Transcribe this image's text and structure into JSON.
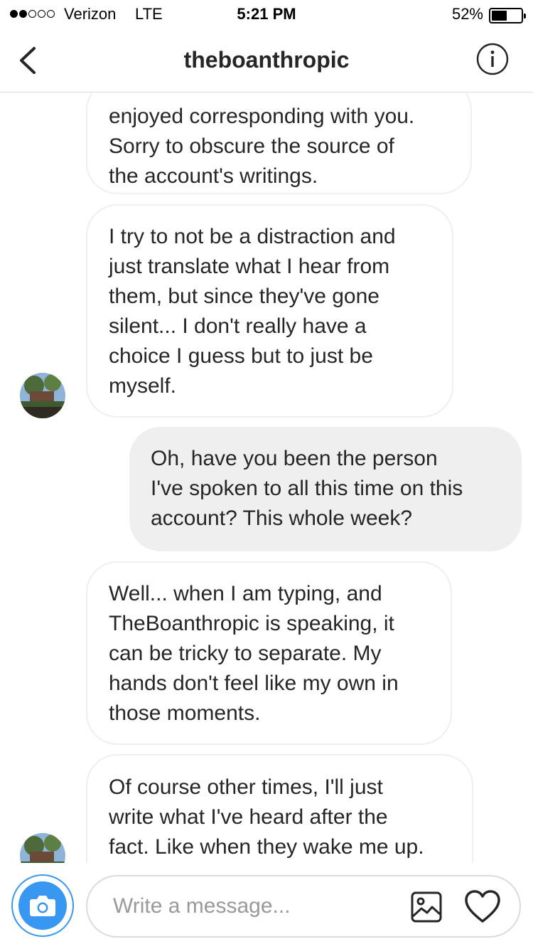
{
  "status_bar": {
    "carrier": "Verizon",
    "network": "LTE",
    "time": "5:21 PM",
    "battery_percent": "52%",
    "battery_level": 0.52,
    "signal_bars_filled": 2,
    "signal_bars_total": 5
  },
  "header": {
    "title": "theboanthropic",
    "back_icon": "chevron-left-icon",
    "info_icon": "info-circle-icon"
  },
  "messages": [
    {
      "direction": "incoming",
      "lines": [
        "enjoyed corresponding with you.",
        "Sorry to obscure the source of",
        "the account's writings."
      ]
    },
    {
      "direction": "incoming",
      "lines": [
        "I try to not be a distraction and",
        "just translate what I hear from",
        "them, but since they've gone",
        "silent... I don't really have a",
        "choice I guess but to just be",
        "myself."
      ]
    },
    {
      "direction": "outgoing",
      "lines": [
        "Oh, have you been the person",
        "I've spoken to all this time on this",
        "account? This whole week?"
      ]
    },
    {
      "direction": "incoming",
      "lines": [
        "Well... when I am typing, and",
        "TheBoanthropic is speaking, it",
        "can be tricky to separate. My",
        "hands don't feel like my own in",
        "those moments."
      ]
    },
    {
      "direction": "incoming",
      "lines": [
        "Of course other times, I'll just",
        "write what I've heard after the",
        "fact. Like when they wake me up."
      ]
    }
  ],
  "composer": {
    "placeholder": "Write a message...",
    "camera_icon": "camera-icon",
    "gallery_icon": "image-gallery-icon",
    "heart_icon": "heart-icon"
  },
  "colors": {
    "accent": "#3897f0",
    "outgoing_bubble": "#efefef",
    "border": "#dbdbdb",
    "text": "#262626"
  }
}
